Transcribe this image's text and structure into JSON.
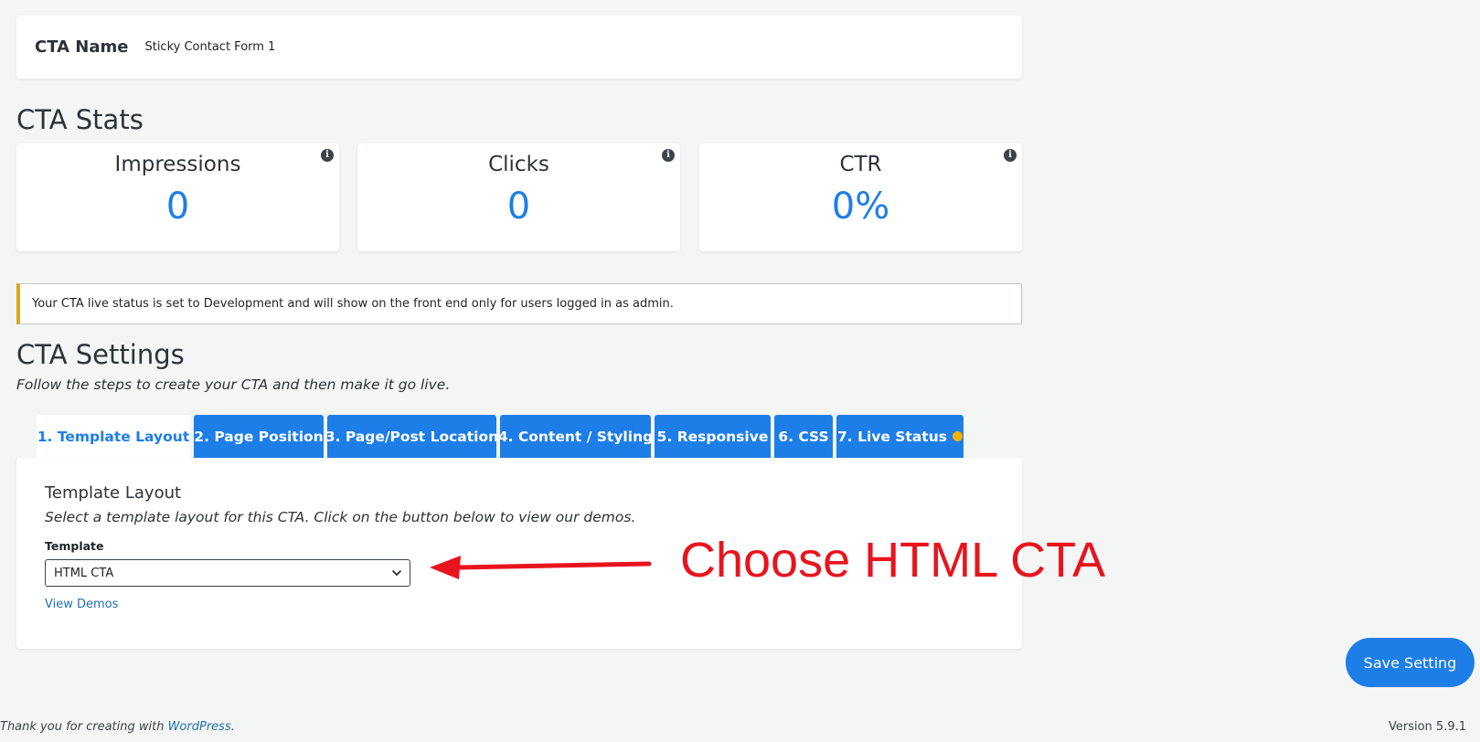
{
  "cta_name": {
    "label": "CTA Name",
    "value": "Sticky Contact Form 1"
  },
  "stats": {
    "heading": "CTA Stats",
    "cards": [
      {
        "title": "Impressions",
        "value": "0"
      },
      {
        "title": "Clicks",
        "value": "0"
      },
      {
        "title": "CTR",
        "value": "0%"
      }
    ],
    "info_icon": "info-icon"
  },
  "notice": {
    "text": "Your CTA live status is set to Development and will show on the front end only for users logged in as admin."
  },
  "settings": {
    "heading": "CTA Settings",
    "subtitle": "Follow the steps to create your CTA and then make it go live.",
    "tabs": [
      {
        "label": "1. Template Layout",
        "active": true
      },
      {
        "label": "2. Page Position",
        "active": false
      },
      {
        "label": "3. Page/Post Location",
        "active": false
      },
      {
        "label": "4. Content / Styling",
        "active": false
      },
      {
        "label": "5. Responsive",
        "active": false
      },
      {
        "label": "6. CSS",
        "active": false
      },
      {
        "label": "7. Live Status",
        "active": false
      }
    ],
    "live_status_color": "#f0b400"
  },
  "panel": {
    "title": "Template Layout",
    "description": "Select a template layout for this CTA. Click on the button below to view our demos.",
    "template_label": "Template",
    "template_value": "HTML CTA",
    "view_demos_link": "View Demos"
  },
  "annotation": {
    "text": "Choose HTML CTA",
    "color": "#e8141d"
  },
  "save_button": "Save Setting",
  "footer": {
    "thanks_prefix": "Thank you for creating with ",
    "thanks_link": "WordPress",
    "thanks_suffix": ".",
    "version": "Version 5.9.1"
  },
  "colors": {
    "accent": "#1e7ee8",
    "background": "#f4f5f5"
  }
}
